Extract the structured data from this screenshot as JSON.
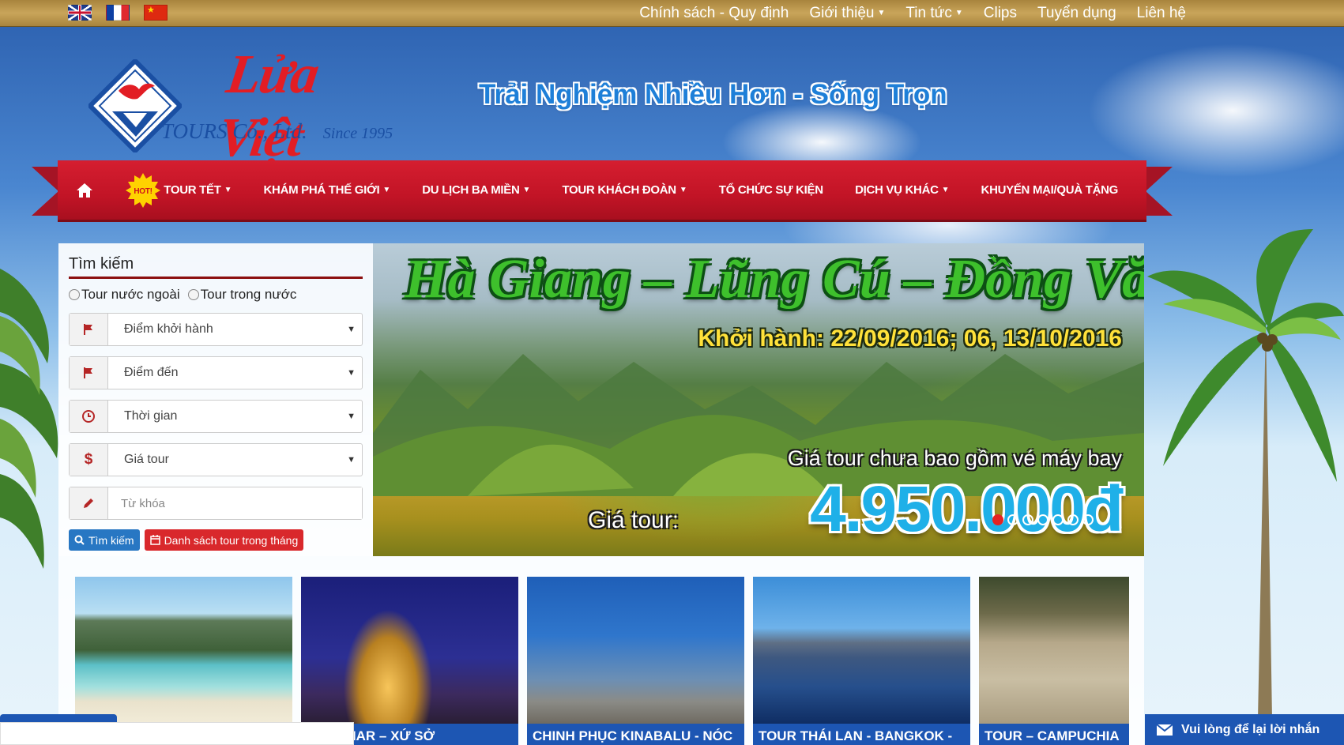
{
  "topbar": {
    "flags": [
      "english-flag",
      "french-flag",
      "chinese-flag"
    ],
    "nav": [
      {
        "label": "Chính sách - Quy định",
        "dropdown": false
      },
      {
        "label": "Giới thiệu",
        "dropdown": true
      },
      {
        "label": "Tin tức",
        "dropdown": true
      },
      {
        "label": "Clips",
        "dropdown": false
      },
      {
        "label": "Tuyển dụng",
        "dropdown": false
      },
      {
        "label": "Liên hệ",
        "dropdown": false
      }
    ]
  },
  "logo": {
    "name": "Lửa Việt",
    "sub": "TOURS Co., Ltd.",
    "since": "Since 1995"
  },
  "slogan": "Trải Nghiệm Nhiều Hơn - Sống Trọn",
  "menu": {
    "hot_badge": "HOT!",
    "items": [
      {
        "label": "TOUR TẾT",
        "dropdown": true
      },
      {
        "label": "KHÁM PHÁ THẾ GIỚI",
        "dropdown": true
      },
      {
        "label": "DU LỊCH BA MIỀN",
        "dropdown": true
      },
      {
        "label": "TOUR KHÁCH ĐOÀN",
        "dropdown": true
      },
      {
        "label": "TỔ CHỨC SỰ KIỆN",
        "dropdown": false
      },
      {
        "label": "DỊCH VỤ KHÁC",
        "dropdown": true
      },
      {
        "label": "KHUYẾN MẠI/QUÀ TẶNG",
        "dropdown": false
      }
    ]
  },
  "search": {
    "title": "Tìm kiếm",
    "radio_foreign": "Tour nước ngoài",
    "radio_domestic": "Tour trong nước",
    "departure": "Điểm khởi hành",
    "destination": "Điểm đến",
    "time": "Thời gian",
    "price": "Giá tour",
    "keyword_placeholder": "Từ khóa",
    "search_button": "Tìm kiếm",
    "monthly_button": "Danh sách tour trong tháng"
  },
  "banner": {
    "title": "Hà Giang – Lũng Cú – Đồng Văn",
    "departure": "Khởi hành: 22/09/2016; 06, 13/10/2016",
    "note": "Giá tour chưa bao gồm vé máy bay",
    "price_label": "Giá tour:",
    "price": "4.950.000đ",
    "slide_count": 7,
    "active_slide": 1
  },
  "cards": [
    {
      "title": ""
    },
    {
      "title": "MYANMAR – XỨ SỞ"
    },
    {
      "title": "CHINH PHỤC KINABALU - NÓC"
    },
    {
      "title": "TOUR THÁI LAN - BANGKOK -"
    },
    {
      "title": "TOUR – CAMPUCHIA"
    }
  ],
  "chat": {
    "label": "Vui lòng để lại lời nhắn"
  },
  "colors": {
    "topbar": "#b8964a",
    "menu_red": "#c8192b",
    "accent_blue": "#1d56b3",
    "price_blue": "#1fb0e8",
    "title_green": "#3ec02c"
  }
}
